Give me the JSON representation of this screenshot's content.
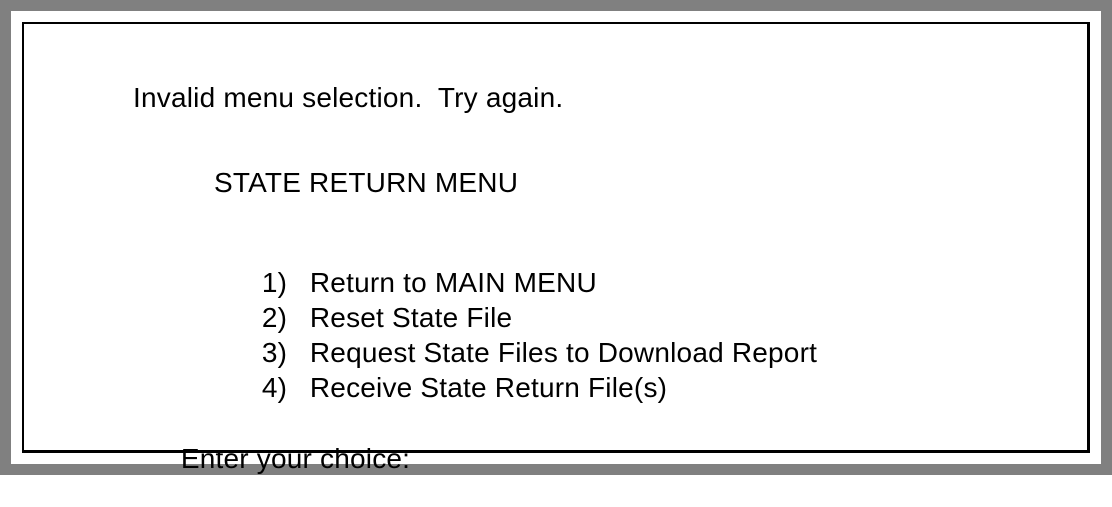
{
  "terminal": {
    "error_message": "Invalid menu selection.  Try again.",
    "menu_title": "STATE RETURN MENU",
    "options": [
      {
        "number": "1)",
        "label": "Return to MAIN MENU"
      },
      {
        "number": "2)",
        "label": "Reset State File"
      },
      {
        "number": "3)",
        "label": "Request State Files to Download Report"
      },
      {
        "number": "4)",
        "label": "Receive State Return File(s)"
      }
    ],
    "prompt": "Enter your choice:"
  },
  "colors": {
    "frame": "#808080",
    "border": "#000000",
    "background": "#ffffff",
    "text": "#000000"
  }
}
